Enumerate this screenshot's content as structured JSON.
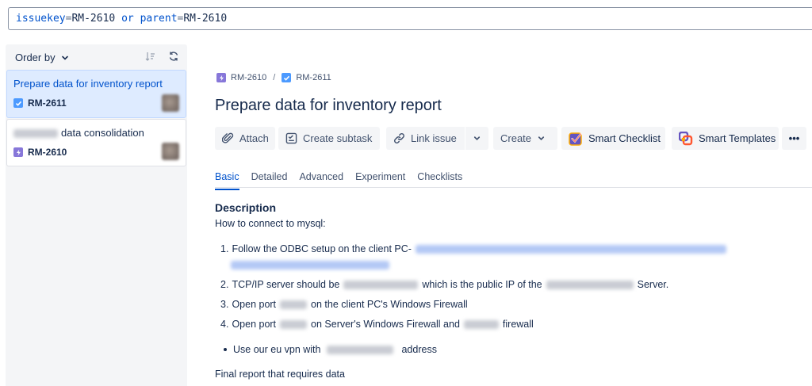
{
  "jql": {
    "field1": "issuekey",
    "eq1": "=",
    "value1": "RM-2610",
    "operator": "or",
    "field2": "parent",
    "eq2": "=",
    "value2": "RM-2610"
  },
  "sidebar": {
    "order_by_label": "Order by",
    "issues": [
      {
        "title": "Prepare data for inventory report",
        "key": "RM-2611",
        "type": "story-icon",
        "selected": true
      },
      {
        "title_suffix": "data consolidation",
        "key": "RM-2610",
        "type": "epic-icon",
        "selected": false
      }
    ]
  },
  "breadcrumb": {
    "parent_key": "RM-2610",
    "separator": "/",
    "current_key": "RM-2611"
  },
  "issue": {
    "title": "Prepare data for inventory report"
  },
  "toolbar": {
    "attach": "Attach",
    "create_subtask": "Create subtask",
    "link_issue": "Link issue",
    "create": "Create",
    "smart_checklist": "Smart Checklist",
    "smart_templates": "Smart Templates",
    "more": "•••"
  },
  "tabs": [
    "Basic",
    "Detailed",
    "Advanced",
    "Experiment",
    "Checklists"
  ],
  "description": {
    "label": "Description",
    "intro": "How to connect to mysql:",
    "step1": {
      "num": "1.",
      "text": "Follow the ODBC setup on the client PC-"
    },
    "step2": {
      "num": "2.",
      "a": "TCP/IP server should be",
      "b": "which is the public IP of the",
      "c": "Server."
    },
    "step3": {
      "num": "3.",
      "a": "Open port",
      "b": "on the client PC's Windows Firewall"
    },
    "step4": {
      "num": "4.",
      "a": "Open port",
      "b": "on Server's Windows Firewall and",
      "c": "firewall"
    },
    "bullet": {
      "a": "Use our eu vpn with",
      "b": "address"
    },
    "final": "Final report that requires data"
  },
  "colors": {
    "accent": "#0052cc",
    "selected_card": "#deebff",
    "panel": "#f4f5f7",
    "story_icon": "#4c9aff",
    "epic_icon": "#8777d9"
  }
}
